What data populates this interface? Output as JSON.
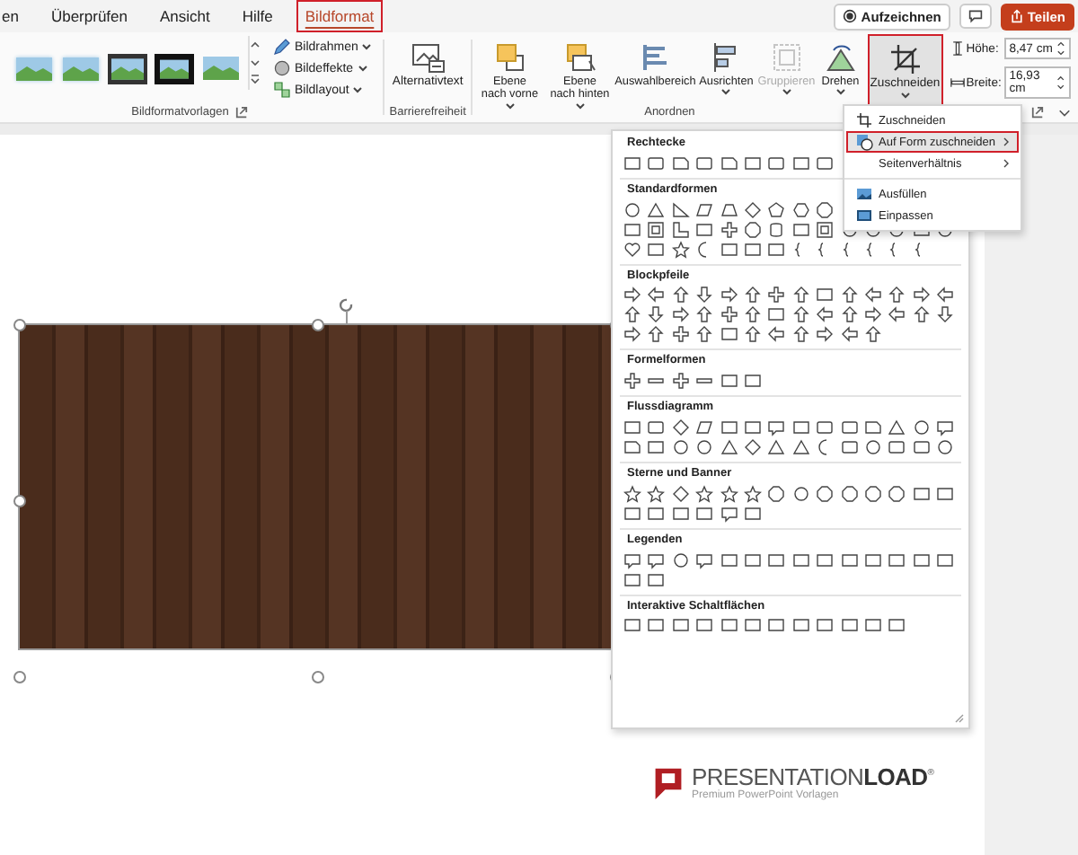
{
  "tabs": [
    {
      "label": "en",
      "selected": false,
      "highlighted": false
    },
    {
      "label": "Überprüfen",
      "selected": false,
      "highlighted": false
    },
    {
      "label": "Ansicht",
      "selected": false,
      "highlighted": false
    },
    {
      "label": "Hilfe",
      "selected": false,
      "highlighted": false
    },
    {
      "label": "Bildformat",
      "selected": true,
      "highlighted": true
    }
  ],
  "title_actions": {
    "record": "Aufzeichnen",
    "share": "Teilen"
  },
  "ribbon": {
    "picture_styles": {
      "label": "Bildformatvorlagen",
      "commands": [
        "Bildrahmen",
        "Bildeffekte",
        "Bildlayout"
      ]
    },
    "accessibility": {
      "label": "Barrierefreiheit",
      "button": "Alternativtext"
    },
    "arrange": {
      "label": "Anordnen",
      "buttons": [
        {
          "label": "Ebene nach vorne",
          "kind": "forward",
          "dropdown": true,
          "disabled": false
        },
        {
          "label": "Ebene nach hinten",
          "kind": "backward",
          "dropdown": true,
          "disabled": false
        },
        {
          "label": "Auswahlbereich",
          "kind": "selection",
          "dropdown": false,
          "disabled": false
        },
        {
          "label": "Ausrichten",
          "kind": "align",
          "dropdown": true,
          "disabled": false
        },
        {
          "label": "Gruppieren",
          "kind": "group",
          "dropdown": true,
          "disabled": true
        },
        {
          "label": "Drehen",
          "kind": "rotate",
          "dropdown": true,
          "disabled": false
        }
      ]
    },
    "crop_button": {
      "label": "Zuschneiden",
      "pressed": true,
      "highlighted": true
    },
    "size": {
      "height_label": "Höhe:",
      "height_value": "8,47 cm",
      "width_label": "Breite:",
      "width_value": "16,93 cm"
    }
  },
  "crop_menu": [
    {
      "label": "Zuschneiden",
      "kind": "crop",
      "submenu": false,
      "selected": false,
      "highlighted": false
    },
    {
      "label": "Auf Form zuschneiden",
      "kind": "shape",
      "submenu": true,
      "selected": true,
      "highlighted": true
    },
    {
      "label": "Seitenverhältnis",
      "kind": "ratio",
      "submenu": true,
      "selected": false,
      "highlighted": false
    },
    {
      "label": "Ausfüllen",
      "kind": "fill",
      "submenu": false,
      "selected": false,
      "highlighted": false
    },
    {
      "label": "Einpassen",
      "kind": "fit",
      "submenu": false,
      "selected": false,
      "highlighted": false
    }
  ],
  "shape_gallery": [
    {
      "heading": "Rechtecke",
      "kind": "rectangles"
    },
    {
      "heading": "Standardformen",
      "kind": "basic"
    },
    {
      "heading": "Blockpfeile",
      "kind": "arrows"
    },
    {
      "heading": "Formelformen",
      "kind": "equation"
    },
    {
      "heading": "Flussdiagramm",
      "kind": "flowchart"
    },
    {
      "heading": "Sterne und Banner",
      "kind": "stars"
    },
    {
      "heading": "Legenden",
      "kind": "callouts"
    },
    {
      "heading": "Interaktive Schaltflächen",
      "kind": "buttons"
    }
  ],
  "slide": {
    "picture": {
      "selected": true
    },
    "logo": {
      "wordmark": "PRESENTATION**LOAD**$^{®}$",
      "tagline": "Premium PowerPoint Vorlagen"
    }
  }
}
